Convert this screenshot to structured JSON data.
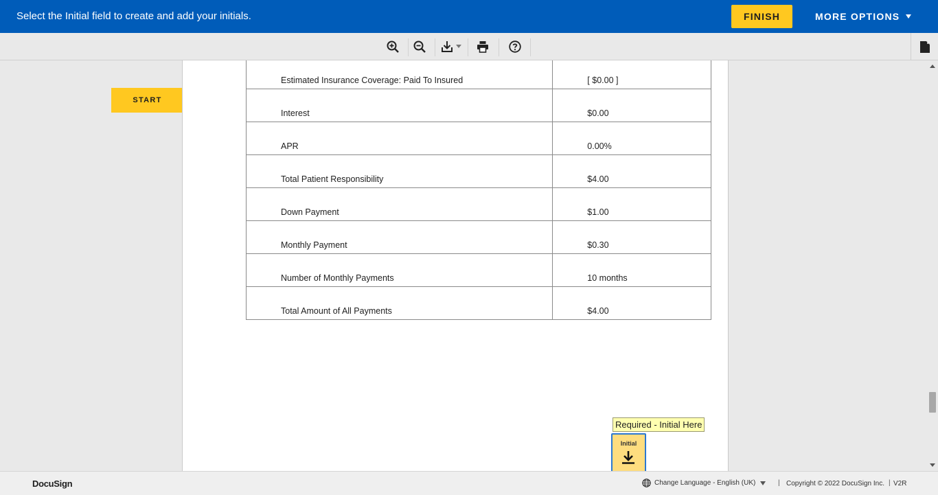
{
  "banner": {
    "message": "Select the Initial field to create and add your initials.",
    "finish_label": "FINISH",
    "more_options_label": "MORE OPTIONS"
  },
  "toolbar": {
    "tools": [
      "zoom-in-icon",
      "zoom-out-icon",
      "download-icon",
      "print-icon",
      "help-icon"
    ],
    "side_panel_icon": "document-icon"
  },
  "navigator": {
    "start_label": "START"
  },
  "document": {
    "rows": [
      {
        "label": "Estimated Insurance Coverage: Paid To Insured",
        "value": "[ $0.00 ]"
      },
      {
        "label": "Interest",
        "value": "$0.00"
      },
      {
        "label": "APR",
        "value": "0.00%"
      },
      {
        "label": "Total Patient Responsibility",
        "value": "$4.00"
      },
      {
        "label": "Down Payment",
        "value": "$1.00"
      },
      {
        "label": "Monthly Payment",
        "value": "$0.30"
      },
      {
        "label": "Number of Monthly Payments",
        "value": "10 months"
      },
      {
        "label": "Total Amount of All Payments",
        "value": "$4.00"
      }
    ],
    "required_tooltip": "Required - Initial Here",
    "initial_tag_label": "Initial"
  },
  "footer": {
    "brand": "DocuSign",
    "language": "Change Language - English (UK)",
    "separator": "|",
    "copyright": "Copyright © 2022 DocuSign Inc.",
    "version": "V2R"
  },
  "colors": {
    "banner": "#005cb9",
    "accent": "#ffc820",
    "initial_tag": "#fedd7f",
    "tooltip": "#ffffb0"
  }
}
